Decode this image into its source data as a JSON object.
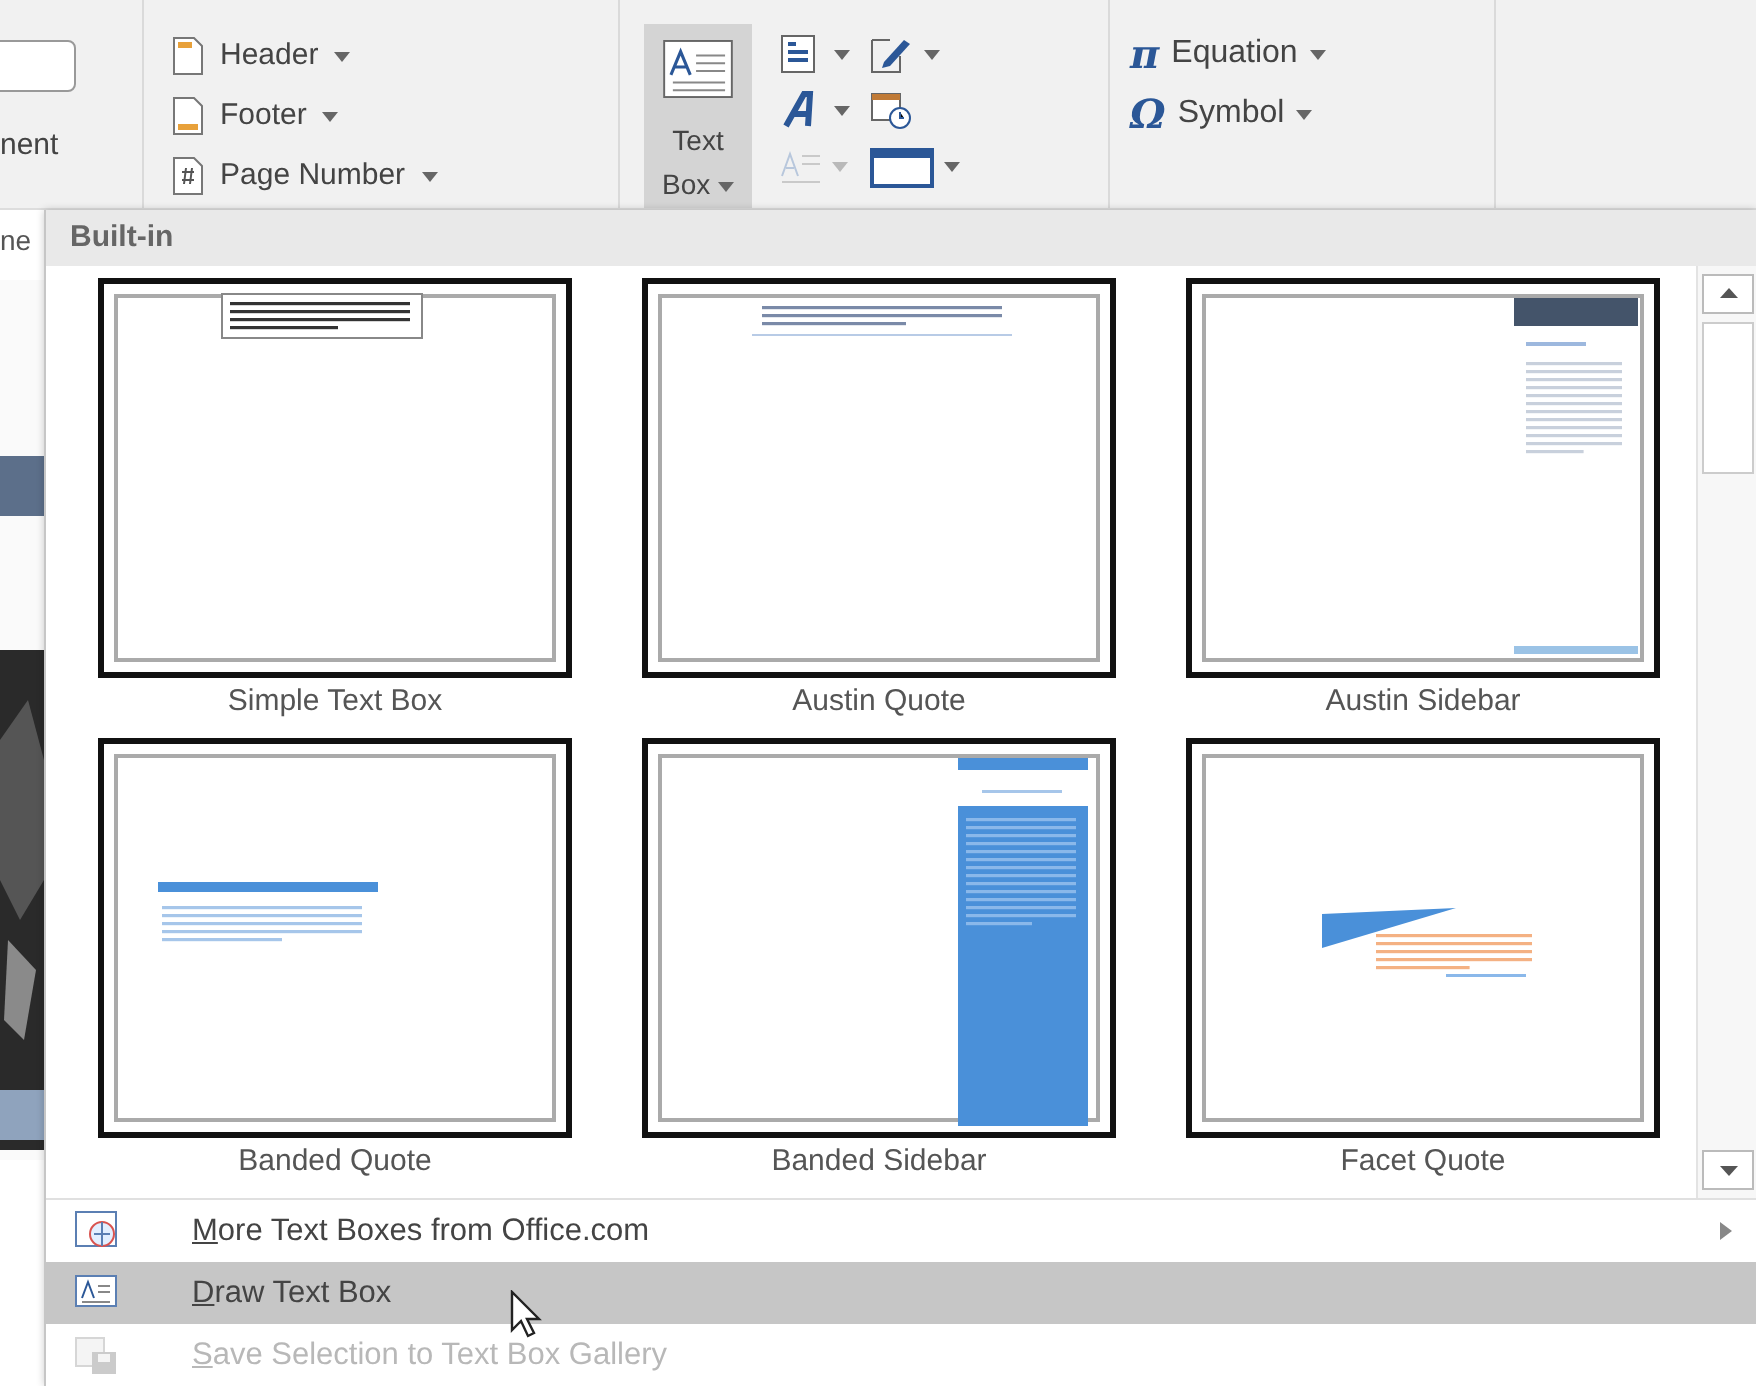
{
  "ribbon": {
    "cut_label": "nent",
    "header_footer": [
      {
        "kind": "header",
        "label": "Header",
        "dropdown": true
      },
      {
        "kind": "footer",
        "label": "Footer",
        "dropdown": true
      },
      {
        "kind": "page-number",
        "label": "Page Number",
        "dropdown": true
      }
    ],
    "text_box_button": {
      "label_lines": [
        "Text",
        "Box"
      ],
      "dropdown": true,
      "pressed": true
    },
    "tools": [
      {
        "kind": "quick-parts",
        "dropdown": true,
        "disabled": false
      },
      {
        "kind": "signature-line",
        "dropdown": true,
        "disabled": false
      },
      {
        "kind": "wordart",
        "dropdown": true,
        "disabled": false
      },
      {
        "kind": "date-time",
        "dropdown": false,
        "disabled": false
      },
      {
        "kind": "drop-cap",
        "dropdown": true,
        "disabled": true
      },
      {
        "kind": "object",
        "dropdown": true,
        "disabled": false
      }
    ],
    "symbols": [
      {
        "glyph": "π",
        "label": "Equation",
        "dropdown": true
      },
      {
        "glyph": "Ω",
        "label": "Symbol",
        "dropdown": true
      }
    ]
  },
  "document_edge": {
    "cut_text": "ne"
  },
  "gallery": {
    "heading": "Built-in",
    "items": [
      {
        "kind": "simple",
        "label": "Simple Text Box"
      },
      {
        "kind": "austin-quote",
        "label": "Austin Quote"
      },
      {
        "kind": "austin-sidebar",
        "label": "Austin Sidebar"
      },
      {
        "kind": "banded-quote",
        "label": "Banded Quote"
      },
      {
        "kind": "banded-sidebar",
        "label": "Banded Sidebar"
      },
      {
        "kind": "facet-quote",
        "label": "Facet Quote"
      }
    ]
  },
  "menu": [
    {
      "kind": "online",
      "label": "More Text Boxes from Office.com",
      "submenu": true,
      "selected": false,
      "disabled": false
    },
    {
      "kind": "draw",
      "label": "Draw Text Box",
      "submenu": false,
      "selected": true,
      "disabled": false
    },
    {
      "kind": "save",
      "label": "Save Selection to Text Box Gallery",
      "submenu": false,
      "selected": false,
      "disabled": true
    }
  ]
}
